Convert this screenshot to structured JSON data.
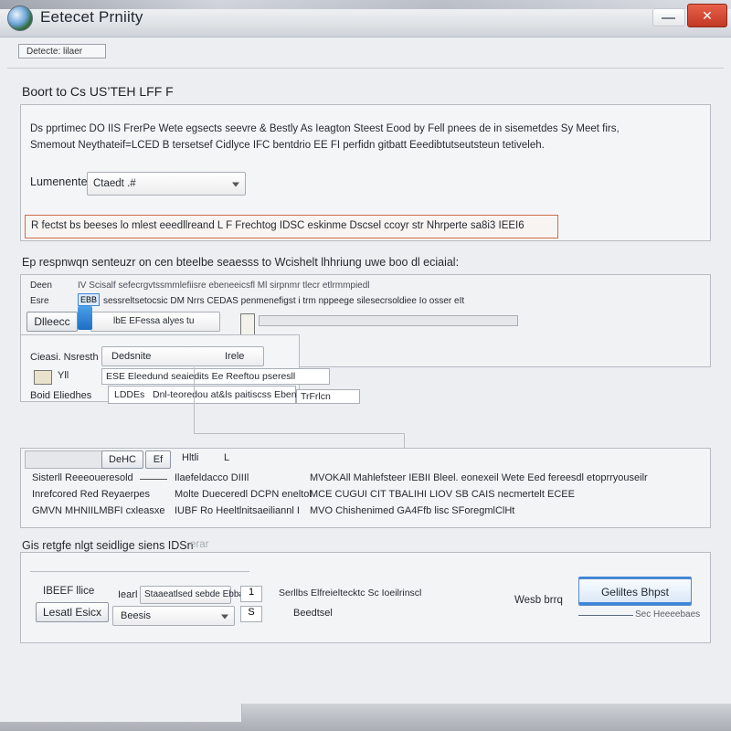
{
  "window": {
    "title": "Eetecet Prniity",
    "close_glyph": "✕",
    "accent": "#3d86d8",
    "close_color": "#c23a25"
  },
  "toolbar": {
    "tab_label": "Detecte: lilaer"
  },
  "section1": {
    "heading": "Boort to Cs US’TEH LFF F",
    "desc_line1": "Ds pprtimec DO IIS FrerPe Wete egsects seevre & Bestly As Ieagton Steest Eood by Fell pnees de in sisemetdes Sy Meet firs,",
    "desc_line2": "Smemout Neythateif=LCED B tersetsef Cidlyce IFC bentdrio EE FI perfidn gitbatt Eeedibtutseutsteun tetiveleh.",
    "lumentum_label": "Lumenenten",
    "lumentum_value": "Ctaedt .#",
    "highlight_text": "R fectst bs beeses lo mlest eeedllreand L F Frechtog IDSC eskinme Dscsel ccoyr str Nhrperte sa8i3 IEEI6",
    "highlight_badge": "IEEI6"
  },
  "section2": {
    "heading": "Ep respnwqn senteuzr on cen bteelbe seaesss to Wcishelt lhhriung uwe boo dl eciaial:",
    "row1_label": "Deen",
    "row1_text": "IV Scisalf sefecrgvtssmmlefiisre ebeneeicsfl Ml sirpnmr tlecr etlrmmpiedl",
    "row2_label": "Esre",
    "row2_badge": "EBB",
    "row2_text": "sessreltsetocsic DM Nrrs CEDAS penmenefigst i trm nppeege silesecrsoldiee Io osser eIt",
    "dropdown_label": "Dlleecc",
    "dropdown_value": "lbE EFessa alyes tu",
    "group_label_a": "Cieasi. Nsresth",
    "group_value_a": "Dedsnite",
    "group_value_a2": "Irele",
    "group_label_b": "Yll",
    "group_value_b": "ESE Eleedund seaiedits Ee Reeftou pseresll",
    "group_label_c": "Boid Eliedhes",
    "group_value_c": "LDDEs",
    "group_text_c": "Dnl-teoredou at&ls paitiscss Ebenaltttio",
    "group_suffix_c": "TrFrlcn"
  },
  "section3": {
    "tab_a": "DeHC",
    "tab_b": "Ef",
    "tab_c": "Hltli",
    "tab_d": "L",
    "rows": [
      {
        "label": "Sisterll Reeeoueresold",
        "mid": "Ilaefeldacco DIIIl",
        "right": "MVOKAll Mahlefsteer IEBII Bleel. eonexeil Wete Eed fereesdl etoprryouseilr"
      },
      {
        "label": "Inrefcored Red Reyaerpes",
        "mid": "Molte Dueceredl DCPN eneltol",
        "right": "MCE CUGUI CIT TBALIHI LIOV SB CAIS necmertelt ECEE"
      },
      {
        "label": "GMVN MHNIILMBFI cxleasxe",
        "mid": "IUBF Ro Heeltlnitsaeiliannl I",
        "right": "MVO Chishenimed GA4Ffb lisc SForegmlClHt"
      }
    ],
    "highlight": "ECEE"
  },
  "section4": {
    "heading": "Gis retgfe nlgt seidlige siens IDSn",
    "faint": "erar",
    "label_a": "IBEEF llice",
    "label_b": "Lesatl Esicx",
    "field_a_label": "Iearl",
    "field_a_value": "Staaeatlsed sebde Ebbat",
    "field_b_value": "Beesis",
    "spin_a": "1",
    "spin_b": "S",
    "side_text": "Serllbs Elfreieltecktc Sc Ioeilrinscl",
    "side_text2": "Beedtsel",
    "right_label": "Wesb brrq",
    "primary_button": "Geliltes Bhpst",
    "right_faint": "Sec Heeeebaes"
  }
}
